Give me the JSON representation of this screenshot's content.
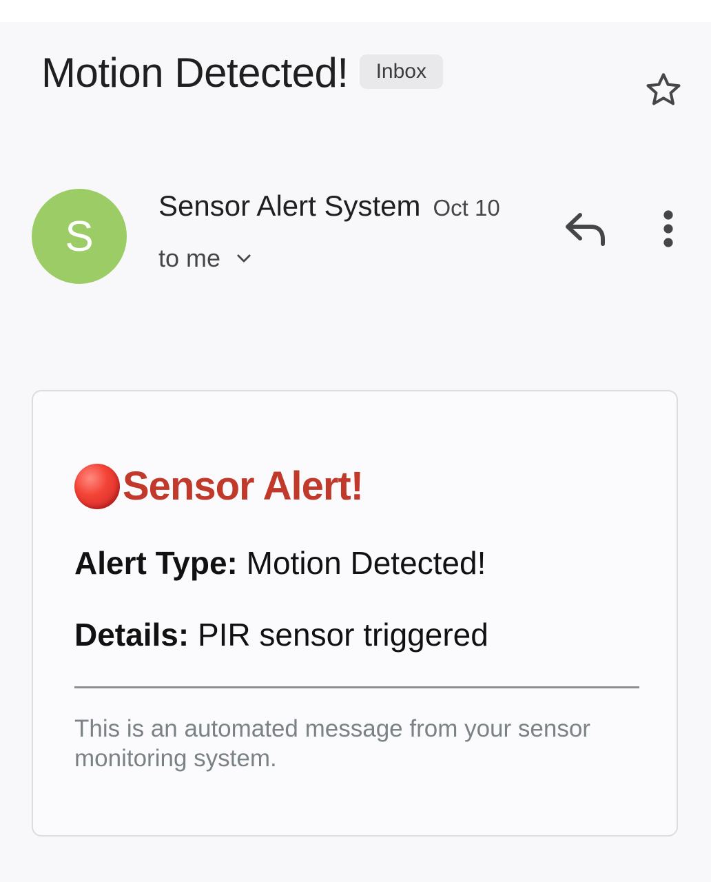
{
  "email": {
    "subject": "Motion Detected!",
    "label": "Inbox",
    "sender": {
      "initial": "S",
      "name": "Sensor Alert System",
      "date": "Oct 10",
      "recipient": "to me",
      "avatar_color": "#9ccc65"
    },
    "icons": {
      "star": "star-outline-icon",
      "reply": "reply-icon",
      "more": "more-vert-icon",
      "expand": "chevron-down-icon",
      "alert": "red-circle-icon"
    },
    "body": {
      "title": "Sensor Alert!",
      "title_color": "#c0392b",
      "alert_type_label": "Alert Type:",
      "alert_type_value": "Motion Detected!",
      "details_label": "Details:",
      "details_value": "PIR sensor triggered",
      "footer": "This is an automated message from your sensor monitoring system."
    }
  }
}
